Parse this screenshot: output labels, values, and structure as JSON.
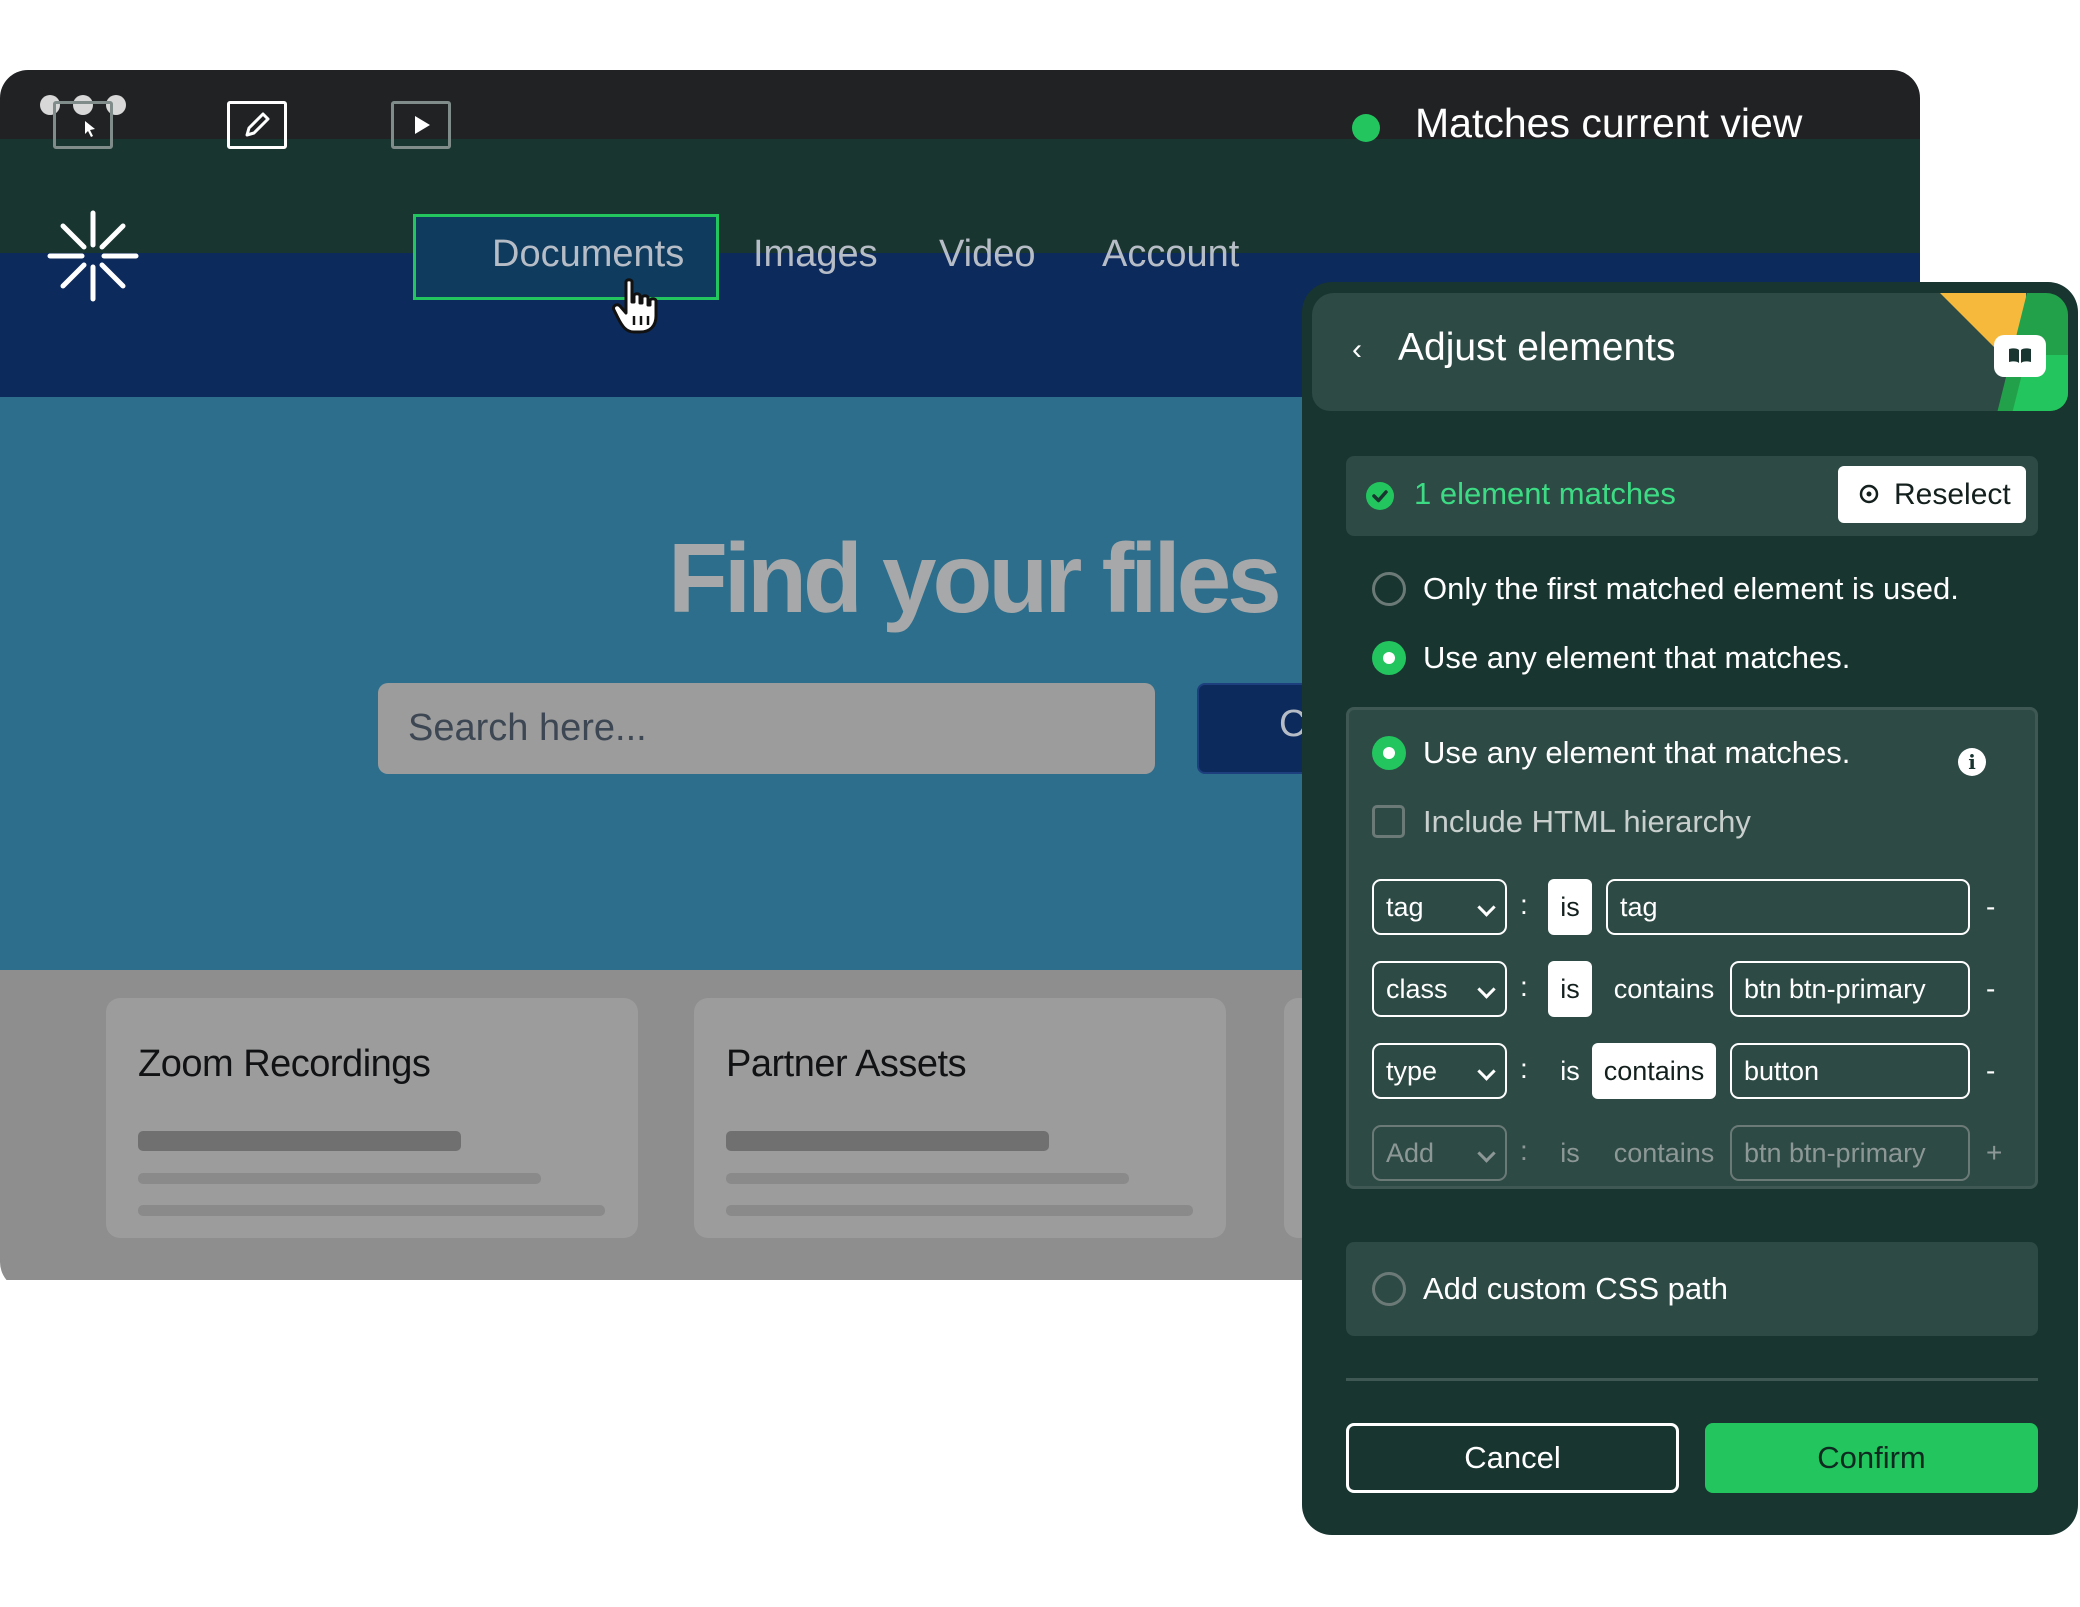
{
  "toolbar": {
    "status_text": "Matches current view",
    "status_color": "#22c55e",
    "icons": [
      "select-element-icon",
      "edit-icon",
      "play-icon"
    ]
  },
  "site": {
    "nav": [
      "Documents",
      "Images",
      "Video",
      "Account"
    ],
    "hero_title": "Find your files",
    "search_placeholder": "Search here...",
    "search_button_label": "C",
    "cards": [
      "Zoom Recordings",
      "Partner Assets"
    ]
  },
  "panel": {
    "title": "Adjust elements",
    "match_text": "1 element matches",
    "reselect_label": "Reselect",
    "options": {
      "first_only": "Only the first matched element is used.",
      "any": "Use any element that matches.",
      "any_inner": "Use any element that matches.",
      "hierarchy": "Include HTML hierarchy",
      "custom_css": "Add custom CSS path"
    },
    "rules": [
      {
        "attr": "tag",
        "op": "is",
        "value": "tag"
      },
      {
        "attr": "class",
        "op": "is",
        "mode": "contains",
        "value": "btn btn-primary"
      },
      {
        "attr": "type",
        "op": "is",
        "mode": "contains",
        "value": "button"
      },
      {
        "attr": "Add",
        "op": "is",
        "mode": "contains",
        "value": "btn btn-primary"
      }
    ],
    "separator": ":",
    "remove_symbol": "-",
    "add_symbol": "+",
    "cancel_label": "Cancel",
    "confirm_label": "Confirm",
    "accent_color": "#22c55e"
  }
}
